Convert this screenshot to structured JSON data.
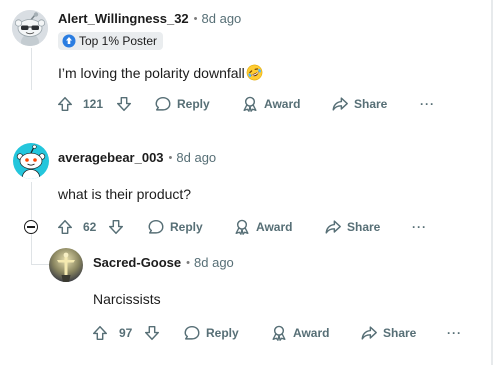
{
  "comments": [
    {
      "username": "Alert_Willingness_32",
      "time": "8d ago",
      "flair": "Top 1% Poster",
      "text": "I’m loving the polarity downfall",
      "emoji": "rolling-on-floor-laughing-emoji",
      "votes": "121",
      "reply_label": "Reply",
      "award_label": "Award",
      "share_label": "Share",
      "more_label": "···"
    },
    {
      "username": "averagebear_003",
      "time": "8d ago",
      "text": "what is their product?",
      "votes": "62",
      "reply_label": "Reply",
      "award_label": "Award",
      "share_label": "Share",
      "more_label": "···"
    },
    {
      "username": "Sacred-Goose",
      "time": "8d ago",
      "text": "Narcissists",
      "votes": "97",
      "reply_label": "Reply",
      "award_label": "Award",
      "share_label": "Share",
      "more_label": "···"
    }
  ],
  "separator": "•",
  "colors": {
    "action_gray": "#576f76",
    "thread_line": "#dfe3e6",
    "flair_bg": "#eaedef",
    "snoo_teal": "#24c6dc"
  }
}
